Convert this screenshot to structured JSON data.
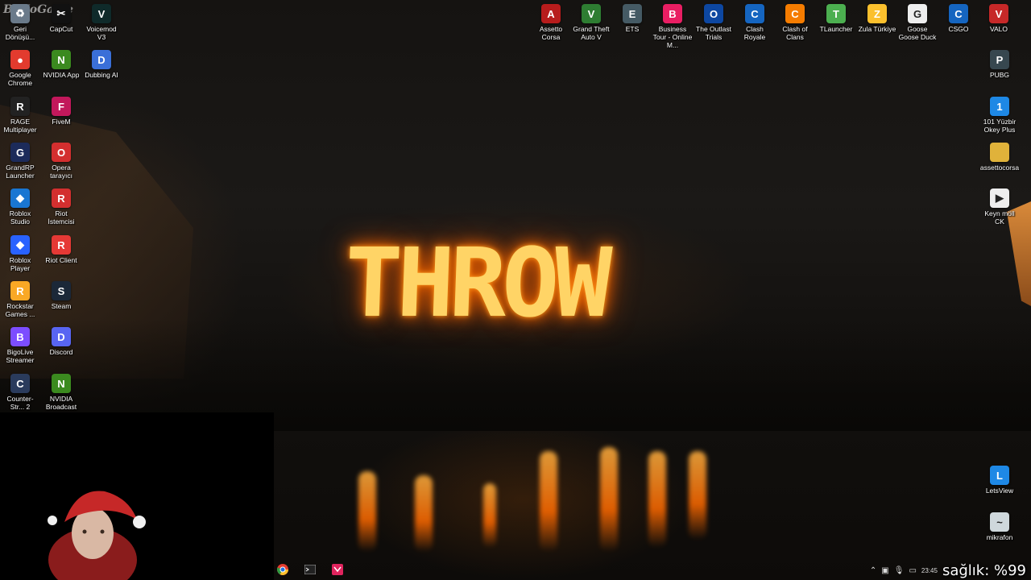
{
  "watermark": "ByNoGame",
  "wallpaper_text": "THROW",
  "left_icons": [
    {
      "label": "Geri Dönüşü...",
      "glyph": "♻",
      "color": "#6a7a8a",
      "name": "recycle-bin-icon"
    },
    {
      "label": "CapCut",
      "glyph": "✂",
      "color": "#111111",
      "name": "capcut-icon"
    },
    {
      "label": "Voicemod V3",
      "glyph": "V",
      "color": "#0f2a2a",
      "name": "voicemod-icon"
    },
    {
      "label": "Google Chrome",
      "glyph": "●",
      "color": "#e23b2e",
      "name": "chrome-icon"
    },
    {
      "label": "NVIDIA App",
      "glyph": "N",
      "color": "#3b8a1f",
      "name": "nvidia-app-icon"
    },
    {
      "label": "Dubbing AI",
      "glyph": "D",
      "color": "#3a6fd8",
      "name": "dubbing-ai-icon"
    },
    {
      "label": "RAGE Multiplayer",
      "glyph": "R",
      "color": "#222222",
      "name": "rage-mp-icon"
    },
    {
      "label": "FiveM",
      "glyph": "F",
      "color": "#c2185b",
      "name": "fivem-icon"
    },
    {
      "label": "GrandRP Launcher",
      "glyph": "G",
      "color": "#1c2b5a",
      "name": "grandrp-icon"
    },
    {
      "label": "Opera tarayıcı",
      "glyph": "O",
      "color": "#d32f2f",
      "name": "opera-icon"
    },
    {
      "label": "Roblox Studio",
      "glyph": "◆",
      "color": "#1976d2",
      "name": "roblox-studio-icon"
    },
    {
      "label": "Riot İstemcisi",
      "glyph": "R",
      "color": "#d32f2f",
      "name": "riot-istemcisi-icon"
    },
    {
      "label": "Roblox Player",
      "glyph": "◆",
      "color": "#2962ff",
      "name": "roblox-player-icon"
    },
    {
      "label": "Riot Client",
      "glyph": "R",
      "color": "#e53935",
      "name": "riot-client-icon"
    },
    {
      "label": "Rockstar Games ...",
      "glyph": "R",
      "color": "#f9a825",
      "name": "rockstar-icon"
    },
    {
      "label": "Steam",
      "glyph": "S",
      "color": "#1b2838",
      "name": "steam-icon"
    },
    {
      "label": "BigoLive Streamer",
      "glyph": "B",
      "color": "#7c4dff",
      "name": "bigolive-icon"
    },
    {
      "label": "Discord",
      "glyph": "D",
      "color": "#5865f2",
      "name": "discord-icon"
    },
    {
      "label": "Counter-Str... 2",
      "glyph": "C",
      "color": "#2a3b5c",
      "name": "counter-strike-icon"
    },
    {
      "label": "NVIDIA Broadcast",
      "glyph": "N",
      "color": "#3b8a1f",
      "name": "nvidia-broadcast-icon"
    }
  ],
  "top_icons": [
    {
      "label": "Assetto Corsa",
      "glyph": "A",
      "color": "#b71c1c",
      "name": "assetto-corsa-icon"
    },
    {
      "label": "Grand Theft Auto V",
      "glyph": "V",
      "color": "#2e7d32",
      "name": "gta-v-icon"
    },
    {
      "label": "ETS",
      "glyph": "E",
      "color": "#455a64",
      "name": "ets-icon"
    },
    {
      "label": "Business Tour - Online M...",
      "glyph": "B",
      "color": "#e91e63",
      "name": "business-tour-icon"
    },
    {
      "label": "The Outlast Trials",
      "glyph": "O",
      "color": "#0d47a1",
      "name": "outlast-trials-icon"
    },
    {
      "label": "Clash Royale",
      "glyph": "C",
      "color": "#1565c0",
      "name": "clash-royale-icon"
    },
    {
      "label": "Clash of Clans",
      "glyph": "C",
      "color": "#f57c00",
      "name": "clash-of-clans-icon"
    },
    {
      "label": "TLauncher",
      "glyph": "T",
      "color": "#4caf50",
      "name": "tlauncher-icon"
    },
    {
      "label": "Zula Türkiye",
      "glyph": "Z",
      "color": "#fbc02d",
      "name": "zula-icon"
    },
    {
      "label": "Goose Goose Duck",
      "glyph": "G",
      "color": "#eeeeee",
      "name": "goose-goose-duck-icon"
    },
    {
      "label": "CSGO",
      "glyph": "C",
      "color": "#1565c0",
      "name": "csgo-icon"
    },
    {
      "label": "VALO",
      "glyph": "V",
      "color": "#c62828",
      "name": "valo-icon"
    }
  ],
  "right_icons": [
    {
      "label": "PUBG",
      "glyph": "P",
      "color": "#37474f",
      "name": "pubg-icon"
    },
    {
      "label": "101 Yüzbir Okey Plus",
      "glyph": "1",
      "color": "#1e88e5",
      "name": "okey-plus-icon"
    },
    {
      "label": "assettocorsa",
      "glyph": "",
      "color": "#e0b23a",
      "name": "folder-icon"
    },
    {
      "label": "Keyn möll CK",
      "glyph": "▶",
      "color": "#eeeeee",
      "name": "video-file-icon"
    },
    {
      "label": "LetsView",
      "glyph": "L",
      "color": "#1e88e5",
      "name": "letsview-icon"
    },
    {
      "label": "mikrafon",
      "glyph": "~",
      "color": "#cfd8dc",
      "name": "audio-file-icon"
    }
  ],
  "tray": {
    "time": "23:45",
    "overlay_text": "sağlık: %99"
  }
}
